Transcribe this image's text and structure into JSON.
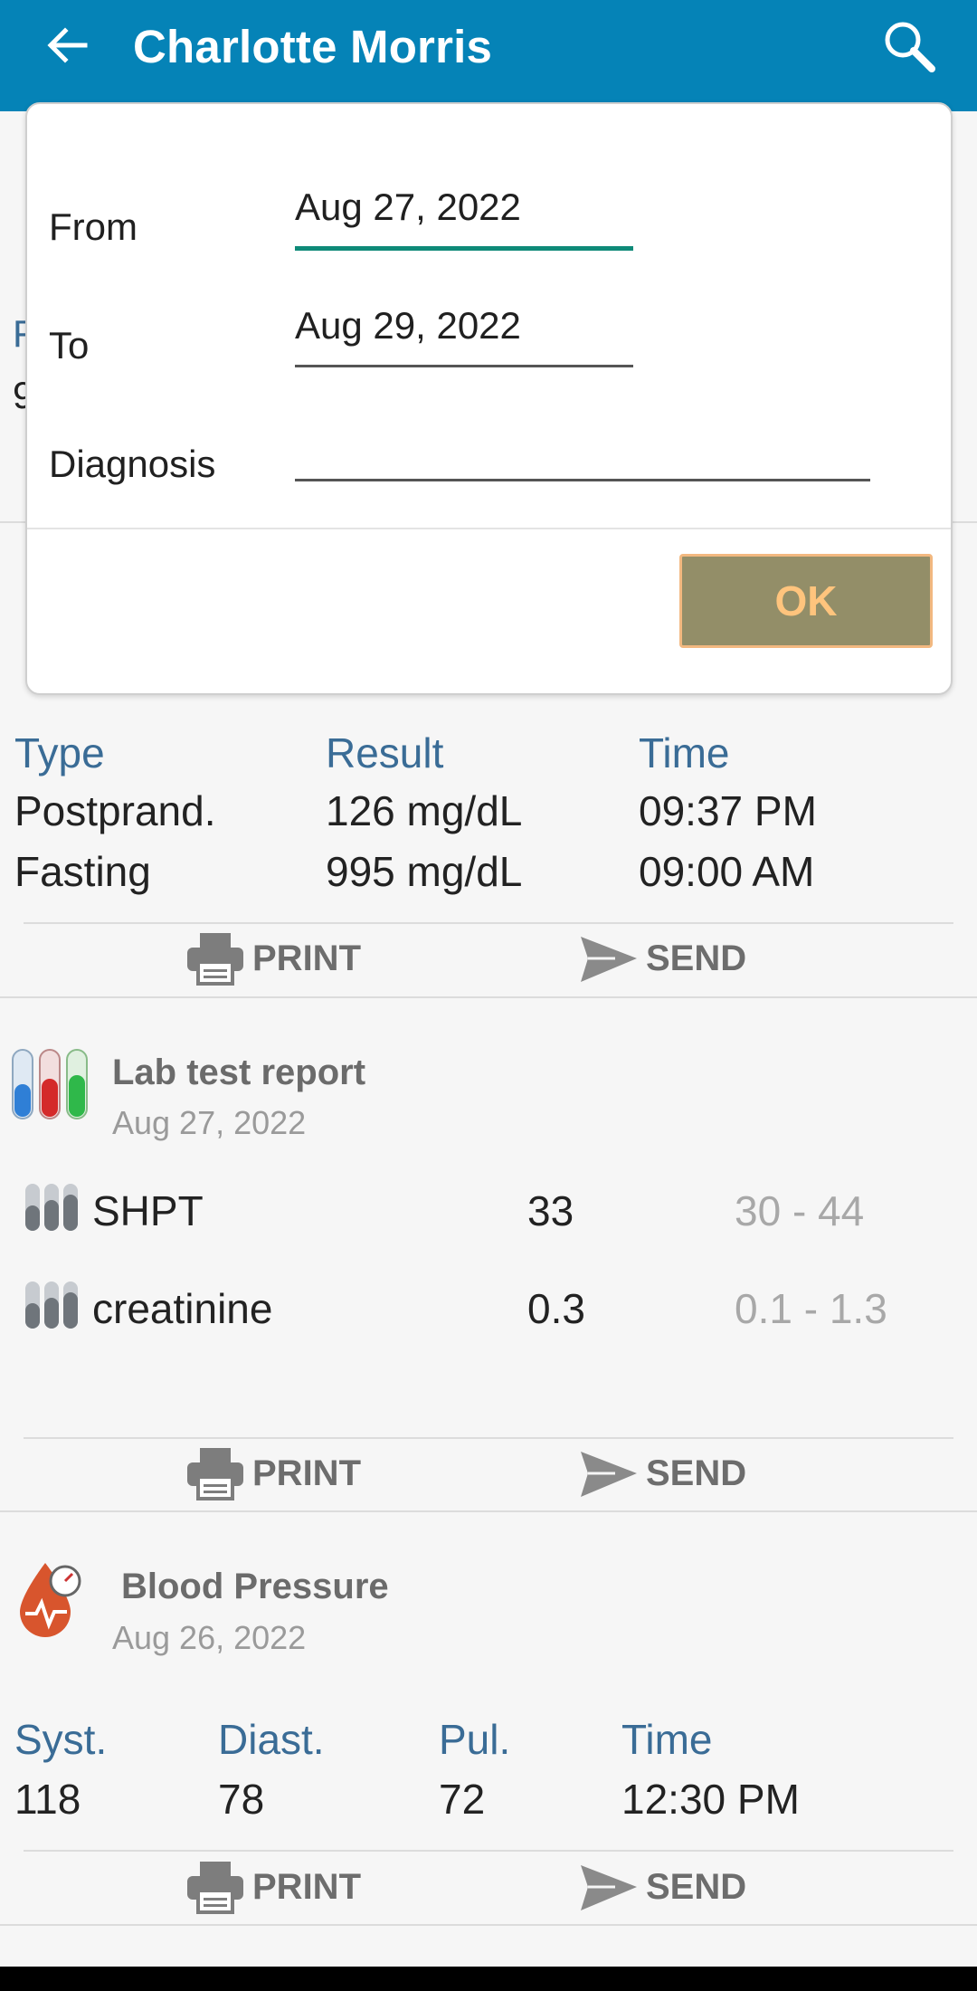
{
  "header": {
    "title": "Charlotte Morris"
  },
  "dialog": {
    "from_label": "From",
    "from_value": "Aug 27, 2022",
    "to_label": "To",
    "to_value": "Aug 29, 2022",
    "diagnosis_label": "Diagnosis",
    "diagnosis_value": "",
    "ok_label": "OK"
  },
  "glucose": {
    "columns": [
      "Type",
      "Result",
      "Time"
    ],
    "rows": [
      {
        "type": "Postprand.",
        "result": "126 mg/dL",
        "time": "09:37 PM"
      },
      {
        "type": "Fasting",
        "result": "995 mg/dL",
        "time": "09:00 AM"
      }
    ]
  },
  "actions": {
    "print": "PRINT",
    "send": "SEND"
  },
  "lab": {
    "title": "Lab test report",
    "date": "Aug 27, 2022",
    "tests": [
      {
        "name": "SHPT",
        "value": "33",
        "range": "30 - 44"
      },
      {
        "name": "creatinine",
        "value": "0.3",
        "range": "0.1 - 1.3"
      }
    ]
  },
  "bp": {
    "title": "Blood Pressure",
    "date": "Aug 26, 2022",
    "columns": [
      "Syst.",
      "Diast.",
      "Pul.",
      "Time"
    ],
    "values": [
      "118",
      "78",
      "72",
      "12:30 PM"
    ]
  },
  "colors": {
    "appbar": "#0583b7",
    "header_text": "#3a6c96",
    "ok_button": "#938e68",
    "focus_line": "#0e8a78"
  }
}
